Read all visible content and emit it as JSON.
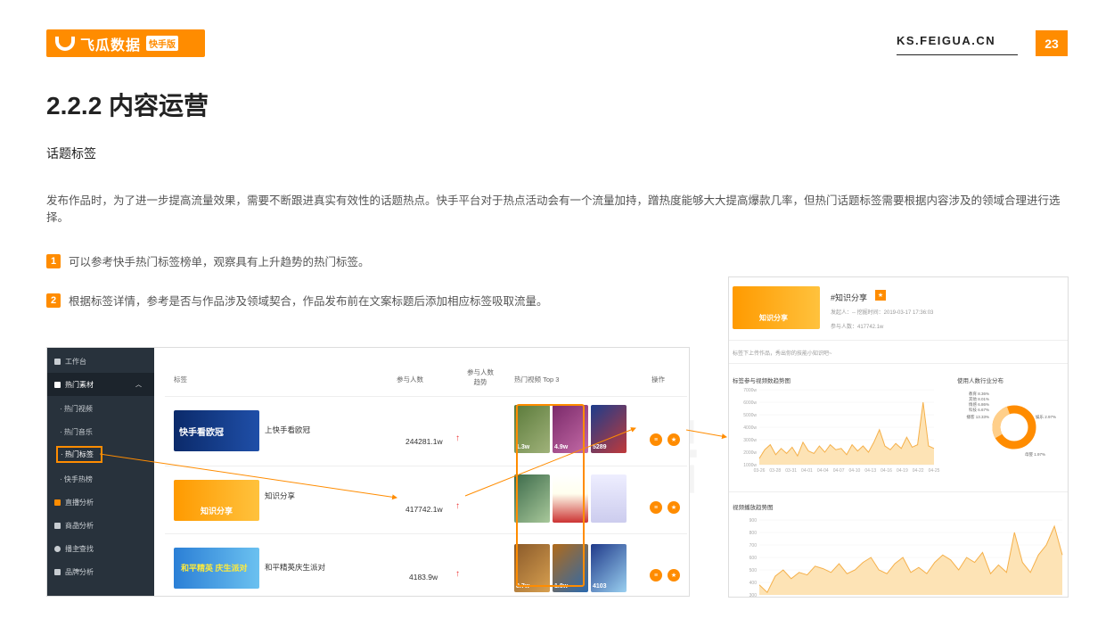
{
  "header": {
    "logo_text": "飞瓜数据",
    "logo_tag": "快手版",
    "site": "KS.FEIGUA.CN",
    "page_number": "23"
  },
  "title": "2.2.2 内容运营",
  "subtitle": "话题标签",
  "paragraph": "发布作品时，为了进一步提高流量效果，需要不断跟进真实有效性的话题热点。快手平台对于热点活动会有一个流量加持，蹭热度能够大大提高爆款几率，但热门话题标签需要根据内容涉及的领域合理进行选择。",
  "points": [
    {
      "num": "1",
      "text": "可以参考快手热门标签榜单，观察具有上升趋势的热门标签。"
    },
    {
      "num": "2",
      "text": "根据标签详情，参考是否与作品涉及领域契合，作品发布前在文案标题后添加相应标签吸取流量。"
    }
  ],
  "left_shot": {
    "sidebar": [
      "工作台",
      "热门素材",
      "· 热门视频",
      "· 热门音乐",
      "· 热门标签",
      "· 快手热榜",
      "直播分析",
      "商品分析",
      "播主查找",
      "品牌分析"
    ],
    "headers": {
      "tag": "标签",
      "participants": "参与人数",
      "trend": "参与人数\n趋势",
      "top3": "热门视频 Top 3",
      "ops": "操作"
    },
    "rows": [
      {
        "thumb_text": "快手看欧冠",
        "name": "上快手看欧冠",
        "participants": "244281.1w",
        "videos": [
          "1.3w",
          "4.9w",
          "5289"
        ]
      },
      {
        "thumb_text": "知识分享",
        "name": "知识分享",
        "participants": "417742.1w",
        "videos": [
          "",
          "",
          ""
        ]
      },
      {
        "thumb_text": "和平精英 庆生派对",
        "name": "和平精英庆生派对",
        "participants": "4183.9w",
        "videos": [
          "8.7w",
          "1.8w",
          "4103"
        ]
      }
    ]
  },
  "right_shot": {
    "tag": "#知识分享",
    "thumb_text": "知识分享",
    "meta1": "发起人：--  挖掘时间：2019-03-17 17:36:03",
    "meta2": "参与人数：417742.1w",
    "desc": "标签下上传作品，秀出你的技能小知识吧~",
    "chart1_title": "标签参与视频数趋势图",
    "chart2_title": "使用人数行业分布",
    "chart3_title": "视频播放趋势图",
    "donut_labels": [
      "教育 8.36%",
      "其他 8.01%",
      "情感 6.86%",
      "科技 6.67%",
      "播客 13.33%",
      "娱乐 2.97%",
      "母婴 1.97%"
    ]
  },
  "chart_data": [
    {
      "type": "area",
      "title": "标签参与视频数趋势图",
      "x": [
        "03-26",
        "03-28",
        "03-31",
        "04-01",
        "04-04",
        "04-07",
        "04-10",
        "04-13",
        "04-16",
        "04-19",
        "04-22",
        "04-25"
      ],
      "ylabels": [
        "7000w",
        "6000w",
        "5000w",
        "4000w",
        "3000w",
        "2000w",
        "1000w"
      ],
      "ylim": [
        1000,
        7000
      ],
      "values": [
        1500,
        2200,
        2600,
        1800,
        2300,
        1900,
        2400,
        1700,
        2800,
        2100,
        1900,
        2500,
        2000,
        2600,
        2200,
        2300,
        1800,
        2600,
        2100,
        2500,
        2000,
        2800,
        3800,
        2500,
        2200,
        2700,
        2300,
        3200,
        2400,
        2600,
        6000,
        2500,
        2300
      ]
    },
    {
      "type": "area",
      "title": "视频播放趋势图",
      "ylabels": [
        "900",
        "800",
        "700",
        "600",
        "500",
        "400",
        "300"
      ],
      "ylim": [
        300,
        900
      ],
      "values": [
        380,
        320,
        450,
        500,
        430,
        480,
        460,
        530,
        510,
        480,
        550,
        470,
        500,
        560,
        600,
        500,
        470,
        550,
        600,
        480,
        520,
        470,
        560,
        620,
        580,
        500,
        600,
        560,
        640,
        470,
        540,
        480,
        800,
        560,
        480,
        620,
        700,
        850,
        620
      ]
    }
  ]
}
